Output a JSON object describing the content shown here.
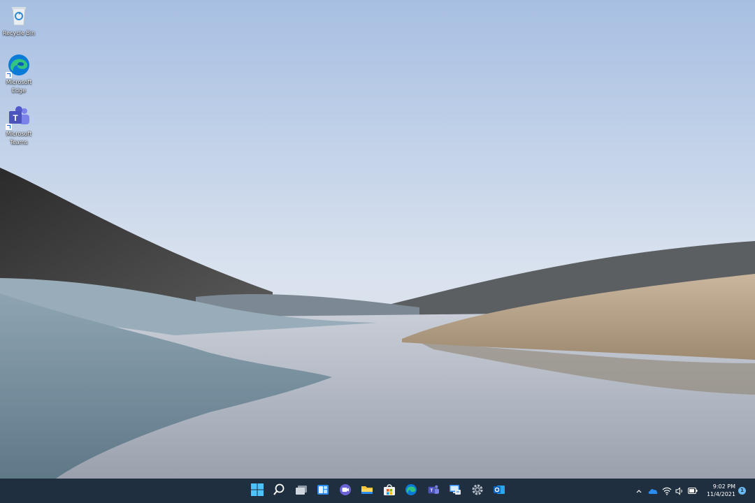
{
  "desktop": {
    "icons": [
      {
        "label": "Recycle Bin",
        "icon": "recycle-bin-icon"
      },
      {
        "label": "Microsoft Edge",
        "icon": "edge-icon"
      },
      {
        "label": "Microsoft Teams",
        "icon": "teams-icon"
      }
    ]
  },
  "taskbar": {
    "apps": [
      {
        "icon": "windows-start-icon"
      },
      {
        "icon": "search-icon"
      },
      {
        "icon": "task-view-icon"
      },
      {
        "icon": "widgets-icon"
      },
      {
        "icon": "chat-icon"
      },
      {
        "icon": "file-explorer-icon"
      },
      {
        "icon": "microsoft-store-icon"
      },
      {
        "icon": "edge-icon"
      },
      {
        "icon": "teams-icon"
      },
      {
        "icon": "remote-desktop-icon"
      },
      {
        "icon": "settings-icon"
      },
      {
        "icon": "outlook-icon"
      }
    ],
    "tray": {
      "time": "9:02 PM",
      "date": "11/4/2021",
      "notifications": "1"
    }
  },
  "colors": {
    "taskbar": "#1f2f3f",
    "accent": "#0078d4"
  }
}
